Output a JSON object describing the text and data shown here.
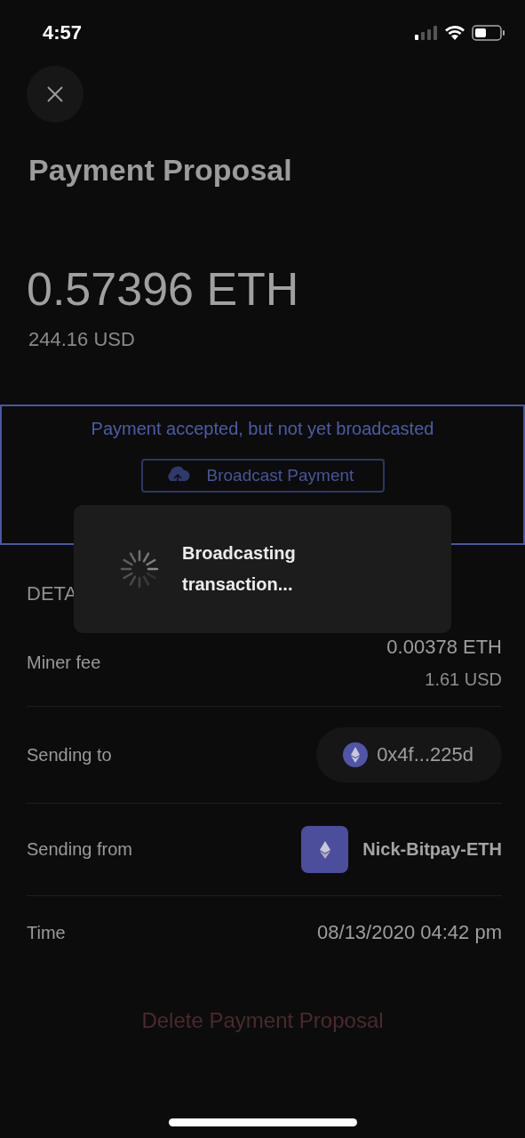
{
  "status_bar": {
    "time": "4:57"
  },
  "title": "Payment Proposal",
  "amount": {
    "crypto": "0.57396 ETH",
    "fiat": "244.16 USD"
  },
  "banner": {
    "message": "Payment accepted, but not yet broadcasted",
    "button": "Broadcast Payment"
  },
  "details": {
    "heading": "DETA",
    "rows": [
      {
        "kind": "amount",
        "label": "Miner fee",
        "value": "0.00378 ETH",
        "sub": "1.61 USD"
      },
      {
        "kind": "address",
        "label": "Sending to",
        "value": "0x4f...225d"
      },
      {
        "kind": "wallet",
        "label": "Sending from",
        "value": "Nick-Bitpay-ETH"
      },
      {
        "kind": "text",
        "label": "Time",
        "value": "08/13/2020 04:42 pm"
      }
    ]
  },
  "delete_button": "Delete Payment Proposal",
  "loading_overlay": {
    "message": "Broadcasting transaction..."
  }
}
